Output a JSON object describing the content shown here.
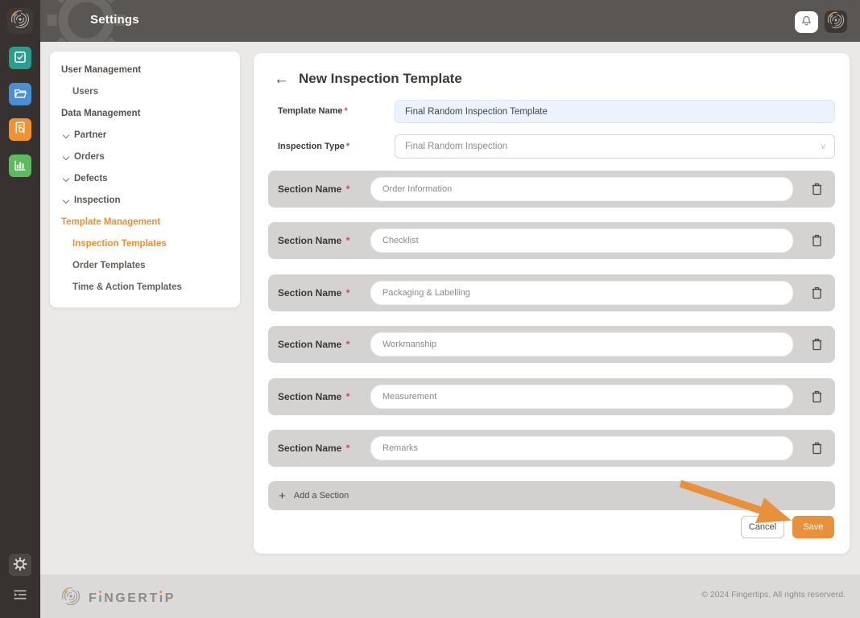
{
  "colors": {
    "accent_orange": "#ef9136",
    "save_button": "#e8913c",
    "rail_background": "#37322f",
    "topbar_background": "#5a5653",
    "icon_teal": "#2a9d8f",
    "icon_blue": "#4a8fd4",
    "icon_orange": "#f0922f",
    "icon_green": "#5cba5f",
    "section_row_gray": "#d4d3d1"
  },
  "topbar": {
    "title": "Settings"
  },
  "sidebar": {
    "groups": [
      {
        "label": "User Management"
      },
      {
        "label": "Data Management"
      },
      {
        "label": "Template Management"
      }
    ],
    "user_items": [
      {
        "label": "Users"
      }
    ],
    "data_items": [
      {
        "label": "Partner"
      },
      {
        "label": "Orders"
      },
      {
        "label": "Defects"
      },
      {
        "label": "Inspection"
      }
    ],
    "template_items": [
      {
        "label": "Inspection Templates"
      },
      {
        "label": "Order Templates"
      },
      {
        "label": "Time & Action Templates"
      }
    ]
  },
  "main": {
    "title": "New Inspection Template",
    "required_mark": "*",
    "fields": {
      "template_name": {
        "label": "Template Name",
        "value": "Final Random Inspection Template"
      },
      "inspection_type": {
        "label": "Inspection Type",
        "value": "Final Random Inspection"
      }
    },
    "section_label": "Section Name",
    "sections": [
      {
        "value": "Order Information"
      },
      {
        "value": "Checklist"
      },
      {
        "value": "Packaging & Labelling"
      },
      {
        "value": "Workmanship"
      },
      {
        "value": "Measurement"
      },
      {
        "value": "Remarks"
      }
    ],
    "add_section_label": "Add a Section",
    "cancel_label": "Cancel",
    "save_label": "Save"
  },
  "footer": {
    "brand_parts": {
      "p1": "F",
      "i1": "ı",
      "p2": "NGERT",
      "i2": "ı",
      "p3": "P"
    },
    "copyright": "© 2024 Fingertips. All rights reserverd."
  }
}
